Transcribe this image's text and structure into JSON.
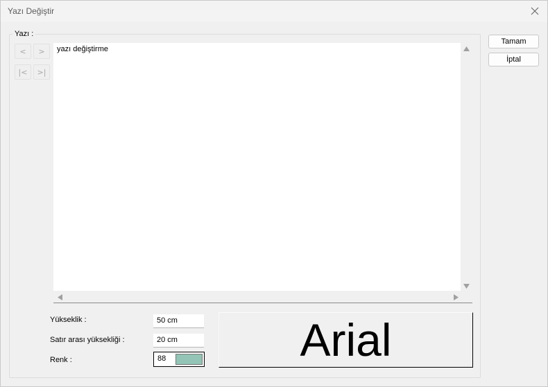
{
  "window": {
    "title": "Yazı Değiştir"
  },
  "group": {
    "label": "Yazı :"
  },
  "nav": {
    "prev": "<",
    "next": ">",
    "first": "|<",
    "last": ">|"
  },
  "editor": {
    "value": "yazı değiştirme"
  },
  "fields": {
    "height_label": "Yükseklik :",
    "height_value": "50 cm",
    "line_height_label": "Satır arası yüksekliği :",
    "line_height_value": "20 cm",
    "color_label": "Renk :",
    "color_value": "88"
  },
  "colors": {
    "swatch": "#93c4b5"
  },
  "preview": {
    "font_name": "Arial"
  },
  "buttons": {
    "ok": "Tamam",
    "cancel": "İptal"
  },
  "icons": [
    "close-icon",
    "scroll-up-icon",
    "scroll-down-icon",
    "scroll-left-icon",
    "scroll-right-icon"
  ]
}
